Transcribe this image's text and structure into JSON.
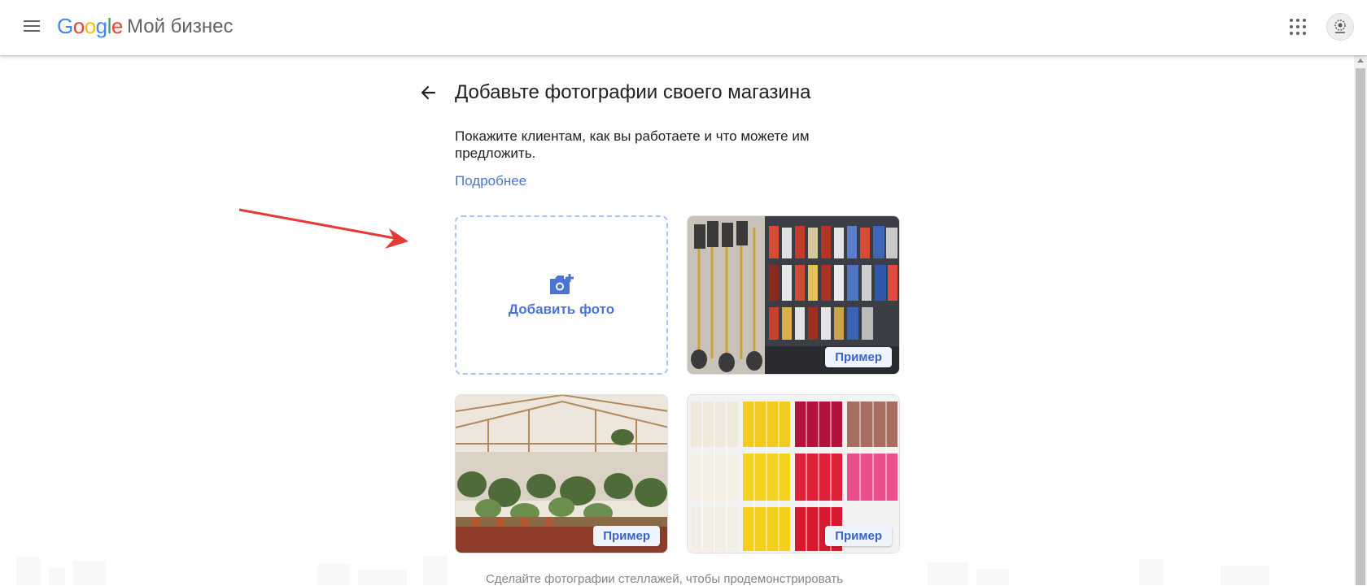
{
  "header": {
    "logo_text": "Google",
    "product_name": "Мой бизнес",
    "menu_icon": "hamburger-menu-icon",
    "apps_icon": "apps-grid-icon",
    "avatar_icon": "account-avatar"
  },
  "page": {
    "title": "Добавьте фотографии своего магазина",
    "description": "Покажите клиентам, как вы работаете и что можете им предложить.",
    "learn_more": "Подробнее",
    "back_icon": "arrow-back-icon"
  },
  "tiles": {
    "add_photo_label": "Добавить фото",
    "add_photo_icon": "add-photo-camera-icon",
    "examples": [
      {
        "badge": "Пример",
        "subject": "tools"
      },
      {
        "badge": "Пример",
        "subject": "plants"
      },
      {
        "badge": "Пример",
        "subject": "candles"
      }
    ]
  },
  "footer_hint": "Сделайте фотографии стеллажей, чтобы продемонстрировать",
  "colors": {
    "accent": "#4a74d5",
    "dashed_border": "#a8c4f0",
    "annotation_arrow": "#e53935"
  }
}
